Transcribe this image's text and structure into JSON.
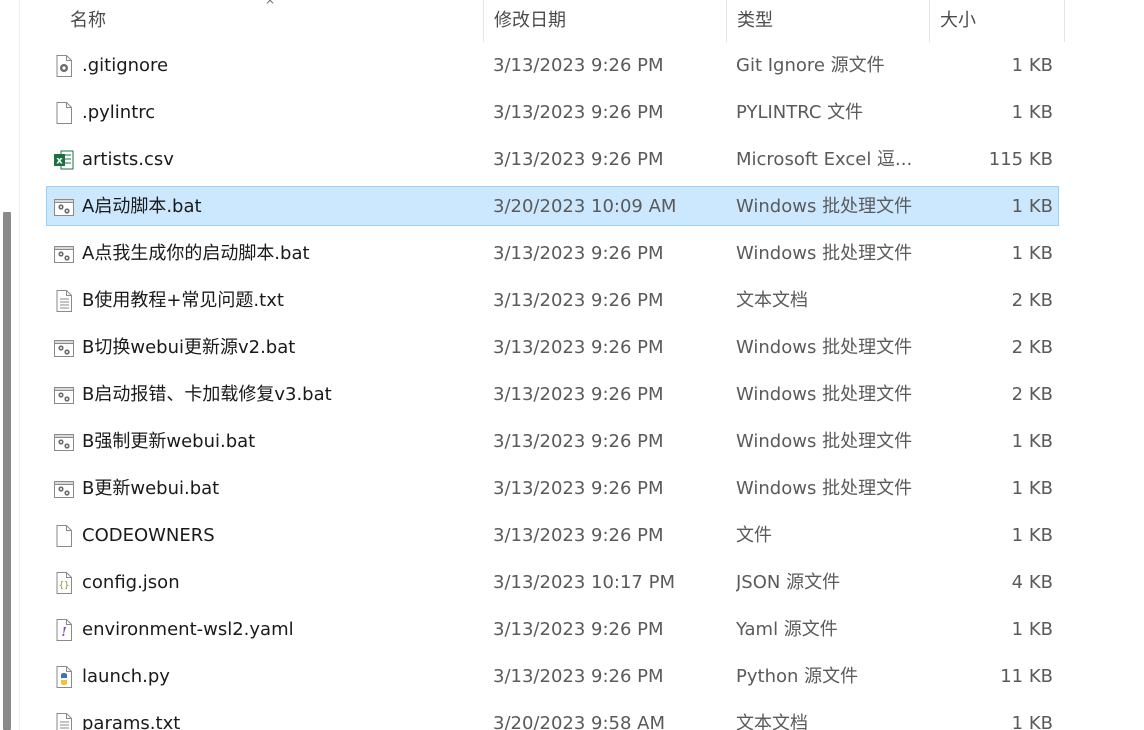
{
  "columns": {
    "name": "名称",
    "date": "修改日期",
    "type": "类型",
    "size": "大小",
    "sort_indicator": "^"
  },
  "selected_index": 3,
  "files": [
    {
      "name": ".gitignore",
      "date": "3/13/2023 9:26 PM",
      "type": "Git Ignore 源文件",
      "size": "1 KB",
      "icon": "settings-file-icon"
    },
    {
      "name": ".pylintrc",
      "date": "3/13/2023 9:26 PM",
      "type": "PYLINTRC 文件",
      "size": "1 KB",
      "icon": "blank-file-icon"
    },
    {
      "name": "artists.csv",
      "date": "3/13/2023 9:26 PM",
      "type": "Microsoft Excel 逗...",
      "size": "115 KB",
      "icon": "excel-file-icon"
    },
    {
      "name": "A启动脚本.bat",
      "date": "3/20/2023 10:09 AM",
      "type": "Windows 批处理文件",
      "size": "1 KB",
      "icon": "batch-file-icon"
    },
    {
      "name": "A点我生成你的启动脚本.bat",
      "date": "3/13/2023 9:26 PM",
      "type": "Windows 批处理文件",
      "size": "1 KB",
      "icon": "batch-file-icon"
    },
    {
      "name": "B使用教程+常见问题.txt",
      "date": "3/13/2023 9:26 PM",
      "type": "文本文档",
      "size": "2 KB",
      "icon": "text-file-icon"
    },
    {
      "name": "B切换webui更新源v2.bat",
      "date": "3/13/2023 9:26 PM",
      "type": "Windows 批处理文件",
      "size": "2 KB",
      "icon": "batch-file-icon"
    },
    {
      "name": "B启动报错、卡加载修复v3.bat",
      "date": "3/13/2023 9:26 PM",
      "type": "Windows 批处理文件",
      "size": "2 KB",
      "icon": "batch-file-icon"
    },
    {
      "name": "B强制更新webui.bat",
      "date": "3/13/2023 9:26 PM",
      "type": "Windows 批处理文件",
      "size": "1 KB",
      "icon": "batch-file-icon"
    },
    {
      "name": "B更新webui.bat",
      "date": "3/13/2023 9:26 PM",
      "type": "Windows 批处理文件",
      "size": "1 KB",
      "icon": "batch-file-icon"
    },
    {
      "name": "CODEOWNERS",
      "date": "3/13/2023 9:26 PM",
      "type": "文件",
      "size": "1 KB",
      "icon": "blank-file-icon"
    },
    {
      "name": "config.json",
      "date": "3/13/2023 10:17 PM",
      "type": "JSON 源文件",
      "size": "4 KB",
      "icon": "json-file-icon"
    },
    {
      "name": "environment-wsl2.yaml",
      "date": "3/13/2023 9:26 PM",
      "type": "Yaml 源文件",
      "size": "1 KB",
      "icon": "yaml-file-icon"
    },
    {
      "name": "launch.py",
      "date": "3/13/2023 9:26 PM",
      "type": "Python 源文件",
      "size": "11 KB",
      "icon": "python-file-icon"
    },
    {
      "name": "params.txt",
      "date": "3/20/2023 9:58 AM",
      "type": "文本文档",
      "size": "1 KB",
      "icon": "text-file-icon"
    }
  ]
}
